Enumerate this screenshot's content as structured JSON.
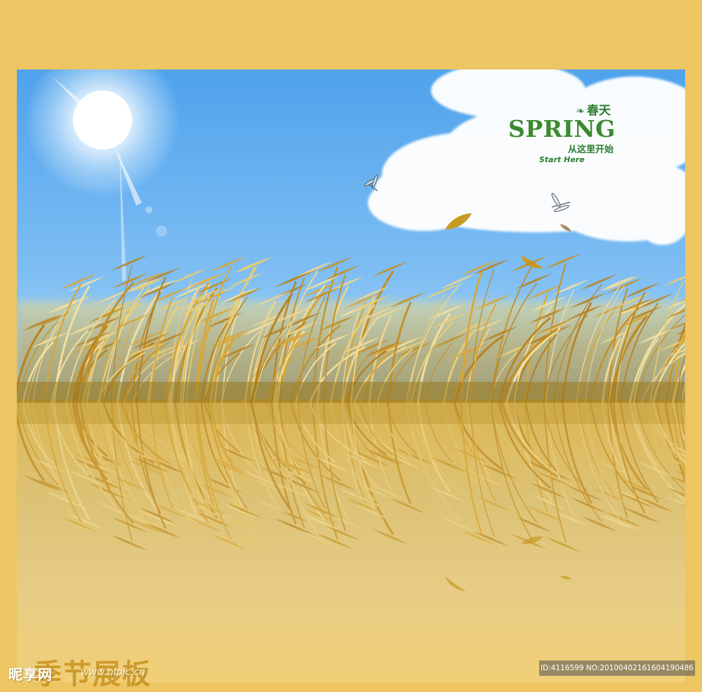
{
  "poster": {
    "brand_mark_cn": "春天",
    "brand_title": "SPRING",
    "brand_subtitle_cn": "从这里开始",
    "brand_subtitle_en": "Start Here"
  },
  "watermark": {
    "site_name": "昵享网",
    "site_url": "www.nipic.cn",
    "theme_text": "季节展板",
    "image_id": "ID:4116599 NO:20100402161604190486"
  },
  "colors": {
    "frame": "#edc562",
    "sky_top": "#5aa8ee",
    "sky_bottom": "#9ed0f6",
    "reed_gold": "#d8a637",
    "brand_green": "#2e7d32"
  }
}
